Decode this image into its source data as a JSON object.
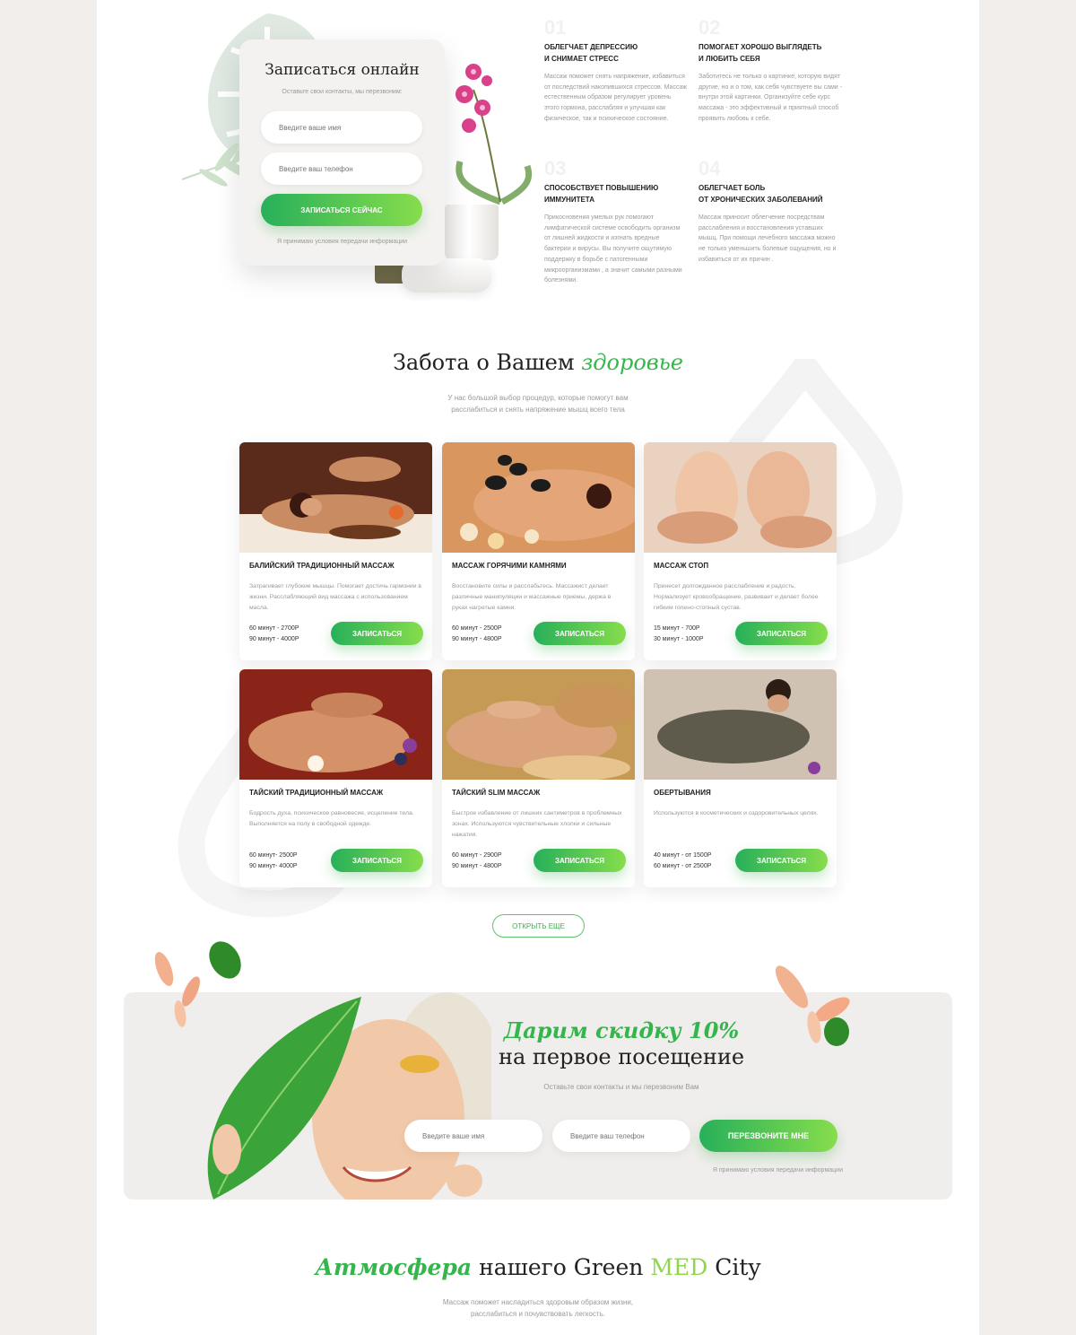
{
  "signup_form": {
    "title": "Записаться онлайн",
    "subtitle": "Оставьте свои контакты, мы перезвоним:",
    "name_placeholder": "Введите ваше имя",
    "phone_placeholder": "Введите ваш телефон",
    "submit_label": "ЗАПИСАТЬСЯ СЕЙЧАС",
    "consent": "Я принимаю условия передачи информации"
  },
  "benefits": [
    {
      "num": "01",
      "title_1": "ОБЛЕГЧАЕТ ДЕПРЕССИЮ",
      "title_2": "И СНИМАЕТ СТРЕСС",
      "text": "Массаж поможет снять напряжение, избавиться от последствий накопившихся стрессов. Массаж естественным образом регулирует уровень этого гормона, расслабляя и улучшая как физическое, так и психическое состояние."
    },
    {
      "num": "02",
      "title_1": "ПОМОГАЕТ ХОРОШО ВЫГЛЯДЕТЬ",
      "title_2": "И ЛЮБИТЬ СЕБЯ",
      "text": "Заботитесь не только о картинке, которую видят другие, но и о том, как себя чувствуете вы сами - внутри этой картинки. Организуйте себе курс массажа - это эффективный и приятный способ проявить любовь к себе."
    },
    {
      "num": "03",
      "title_1": "СПОСОБСТВУЕТ ПОВЫШЕНИЮ",
      "title_2": "ИММУНИТЕТА",
      "text": "Прикосновения умелых рук помогают лимфатической системе освободить организм от лишней жидкости и изгнать вредные бактерии и вирусы. Вы получите ощутимую поддержку в борьбе с патогенными микроорганизмами , а значит самыми разными болезнями."
    },
    {
      "num": "04",
      "title_1": "ОБЛЕГЧАЕТ БОЛЬ",
      "title_2": "ОТ ХРОНИЧЕСКИХ ЗАБОЛЕВАНИЙ",
      "text": "Массаж приносит облегчение посредствам расслабления и восстановления уставших мышц. При помощи лечебного массажа можно не только уменьшить болевые ощущения, но и избавиться от их причин ."
    }
  ],
  "services_section": {
    "title_plain": "Забота о Вашем",
    "title_accent": "здоровье",
    "subtitle_1": "У нас большой выбор процедур, которые помогут вам",
    "subtitle_2": "расслабиться и снять напряжение мышц всего тела",
    "more_label": "ОТКРЫТЬ ЕЩЕ"
  },
  "services": [
    {
      "title": "БАЛИЙСКИЙ ТРАДИЦИОННЫЙ МАССАЖ",
      "desc": "Затрагивает глубокие мышцы. Помогает достичь гармонии в жизни. Расслабляющий вид массажа с использованием масла.",
      "price_1": "60 минут - 2700Р",
      "price_2": "90 минут - 4000Р",
      "button": "ЗАПИСАТЬСЯ"
    },
    {
      "title": "МАССАЖ ГОРЯЧИМИ КАМНЯМИ",
      "desc": "Восстановите силы и расслабьтесь. Массажист делает различные манипуляции и массажные приемы, держа в руках нагретые камни.",
      "price_1": "60 минут - 2500Р",
      "price_2": "90 минут - 4800Р",
      "button": "ЗАПИСАТЬСЯ"
    },
    {
      "title": "МАССАЖ СТОП",
      "desc": "Принесет долгожданное расслабление и радость. Нормализует кровообращение, развивает и делает более гибким голено-стопный сустав.",
      "price_1": "15 минут - 700Р",
      "price_2": "30 минут - 1000Р",
      "button": "ЗАПИСАТЬСЯ"
    },
    {
      "title": "ТАЙСКИЙ ТРАДИЦИОННЫЙ МАССАЖ",
      "desc": "Бодрость духа, психическое равновесие, исцеление тела. Выполняется на полу в свободной одежде.",
      "price_1": "60 минут- 2500Р",
      "price_2": "90 минут- 4000Р",
      "button": "ЗАПИСАТЬСЯ"
    },
    {
      "title": "ТАЙСКИЙ SLIM МАССАЖ",
      "desc": "Быстрое избавление от лишних сантиметров в проблемных зонах. Используются чувствительные хлопки и сильные нажатия.",
      "price_1": "60 минут - 2900Р",
      "price_2": "90 минут - 4800Р",
      "button": "ЗАПИСАТЬСЯ"
    },
    {
      "title": "ОБЕРТЫВАНИЯ",
      "desc": "Используются в косметических и оздоровительных целях.",
      "price_1": "40 минут - от 1500Р",
      "price_2": "60 минут - от 2500Р",
      "button": "ЗАПИСАТЬСЯ"
    }
  ],
  "promo": {
    "title": "Дарим скидку 10%",
    "subtitle": "на первое посещение",
    "note": "Оставьте свои контакты и мы перезвоним Вам",
    "name_placeholder": "Введите ваше имя",
    "phone_placeholder": "Введите ваш телефон",
    "button": "ПЕРЕЗВОНИТЕ МНЕ",
    "consent": "Я принимаю условия передачи информации"
  },
  "atmosphere": {
    "title_accent": "Атмосфера",
    "title_mid": "нашего Green",
    "title_med": "MED",
    "title_end": "City",
    "sub_1": "Массаж поможет насладиться здоровым образом жизни,",
    "sub_2": "расслабиться и почувствовать легкость."
  },
  "colors": {
    "accent": "#35b64c",
    "gradient_start": "#27b05a",
    "gradient_end": "#87dd4c",
    "background": "#f1eeec"
  }
}
